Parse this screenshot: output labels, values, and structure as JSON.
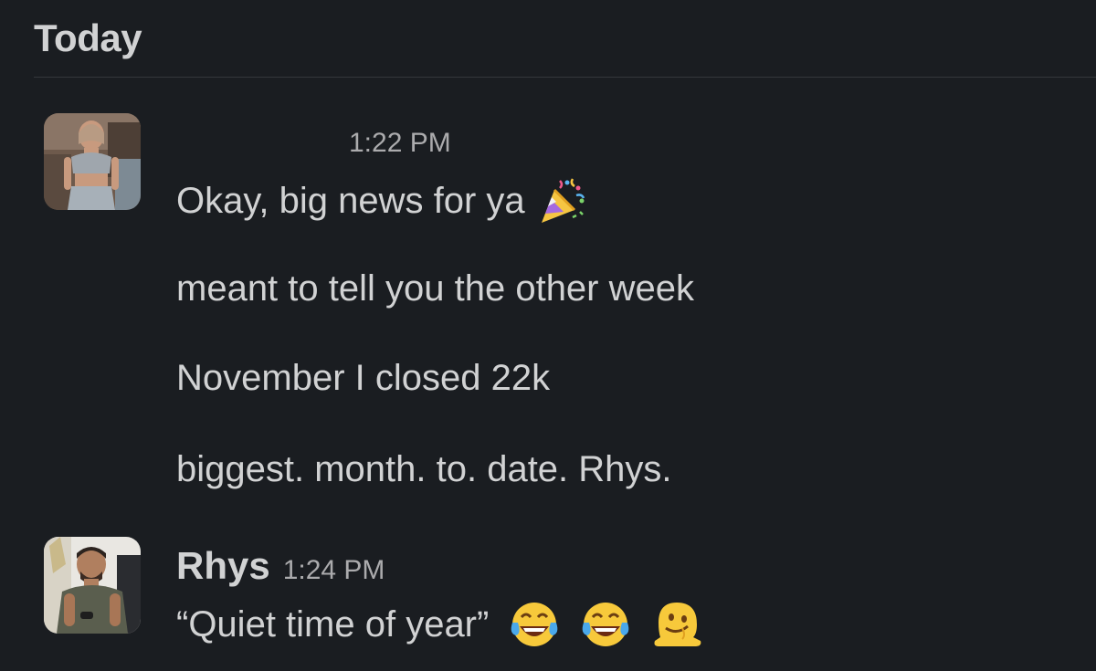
{
  "day_header": "Today",
  "messages": [
    {
      "sender": "",
      "timestamp": "1:22 PM",
      "avatar_icon": "avatar-woman-photo",
      "lines": [
        "Okay, big news for ya",
        "meant to tell you the other week",
        "November I closed 22k",
        "biggest. month. to. date. Rhys."
      ],
      "emojis": [
        "party-popper-icon"
      ]
    },
    {
      "sender": "Rhys",
      "timestamp": "1:24 PM",
      "avatar_icon": "avatar-man-photo",
      "lines": [
        "“Quiet time of year”"
      ],
      "emojis": [
        "tears-of-joy-icon",
        "tears-of-joy-icon",
        "melting-face-icon"
      ]
    }
  ],
  "colors": {
    "background": "#1a1d21",
    "text": "#d1d2d3",
    "muted": "#ababad",
    "divider": "#35373b"
  }
}
